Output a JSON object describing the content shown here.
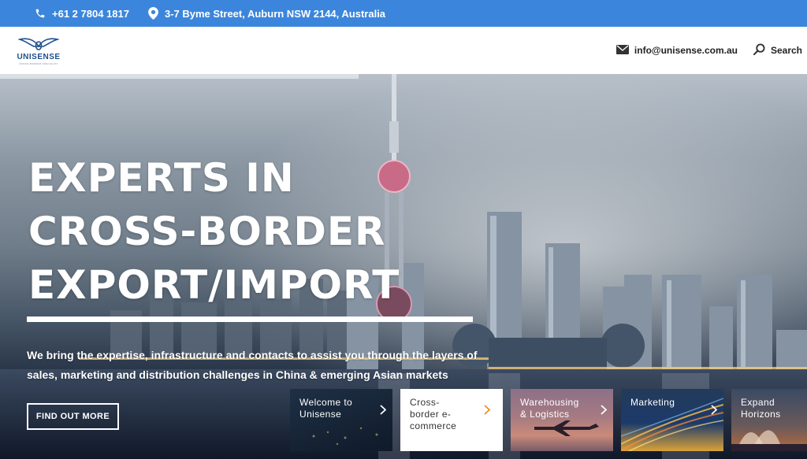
{
  "topbar": {
    "phone": "+61 2 7804 1817",
    "address": "3-7 Byme Street, Auburn NSW 2144, Australia",
    "icons": {
      "phone": "phone-icon",
      "address": "map-pin-icon"
    }
  },
  "header": {
    "logo_name": "UNISENSE",
    "logo_tagline": "CROSS-BORDER SPECIALIST",
    "email": "info@unisense.com.au",
    "search_label": "Search",
    "icons": {
      "email": "envelope-icon",
      "search": "search-icon"
    }
  },
  "hero": {
    "headline_line1": "EXPERTS IN",
    "headline_line2": "CROSS-BORDER",
    "headline_line3": "EXPORT/IMPORT",
    "subcopy": "We bring the expertise, infrastructure and contacts to assist you through the layers of sales, marketing and distribution challenges in China & emerging Asian markets",
    "cta_label": "FIND OUT MORE"
  },
  "tiles": [
    {
      "label": "Welcome to Unisense",
      "icon": "chevron-right-icon"
    },
    {
      "label": "Cross-border e-commerce",
      "icon": "chevron-right-icon"
    },
    {
      "label": "Warehousing & Logistics",
      "icon": "chevron-right-icon"
    },
    {
      "label": "Marketing",
      "icon": "chevron-right-icon"
    },
    {
      "label": "Expand Horizons",
      "icon": "chevron-right-icon"
    }
  ],
  "colors": {
    "topbar": "#3b86dc",
    "accent_orange": "#f08a24",
    "logo_blue": "#1f4f8f"
  }
}
